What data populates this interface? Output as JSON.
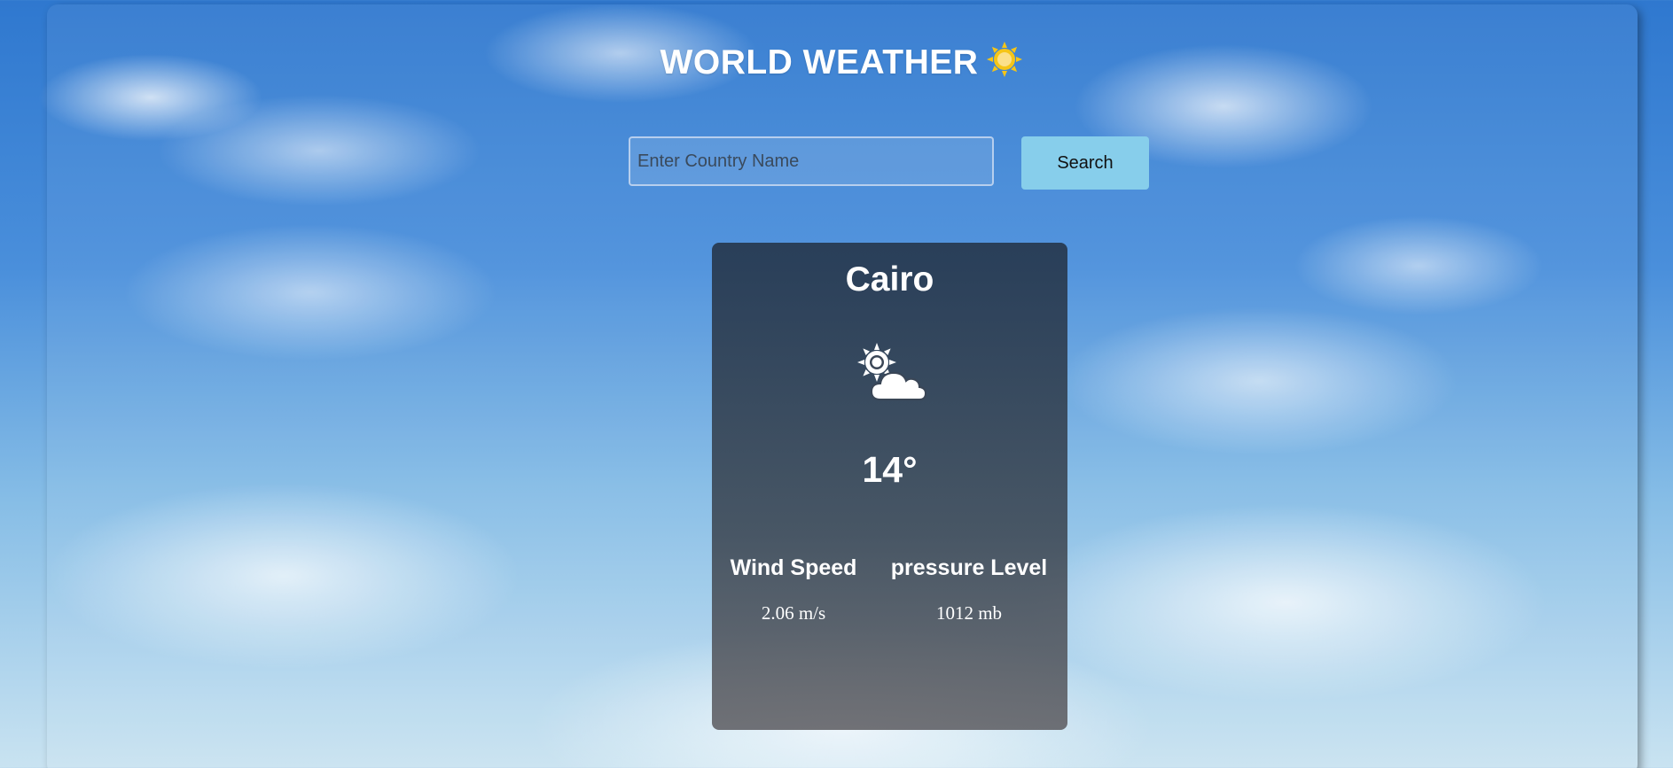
{
  "header": {
    "title": "WORLD WEATHER",
    "title_icon": "sun-icon",
    "icon_color": "#f5c518"
  },
  "search": {
    "placeholder": "Enter Country Name",
    "value": "",
    "button_label": "Search",
    "button_color": "#87ceeb"
  },
  "weather_card": {
    "city": "Cairo",
    "condition_icon": "partly-cloudy-icon",
    "temperature": "14°",
    "wind": {
      "label": "Wind Speed",
      "value": "2.06 m/s"
    },
    "pressure": {
      "label": "pressure Level",
      "value": "1012 mb"
    }
  }
}
